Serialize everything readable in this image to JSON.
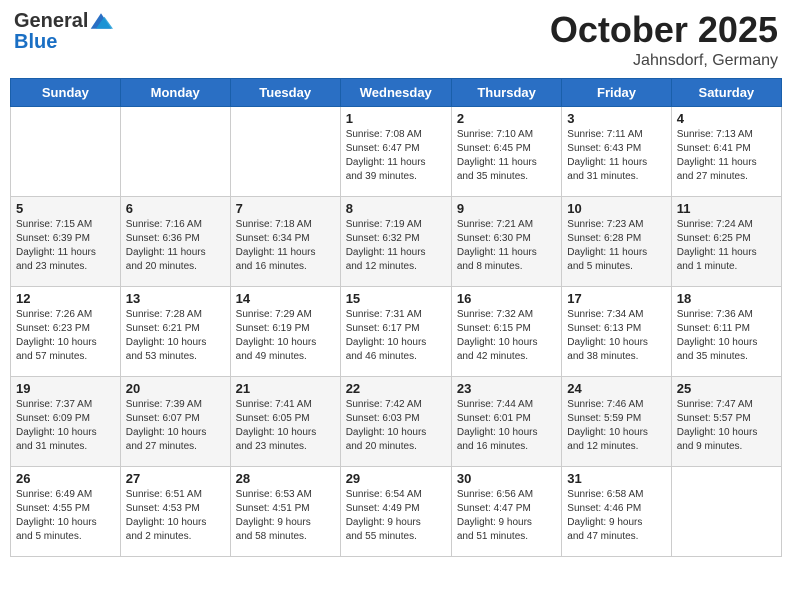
{
  "header": {
    "logo_general": "General",
    "logo_blue": "Blue",
    "month": "October 2025",
    "location": "Jahnsdorf, Germany"
  },
  "days_of_week": [
    "Sunday",
    "Monday",
    "Tuesday",
    "Wednesday",
    "Thursday",
    "Friday",
    "Saturday"
  ],
  "weeks": [
    [
      {
        "day": "",
        "info": ""
      },
      {
        "day": "",
        "info": ""
      },
      {
        "day": "",
        "info": ""
      },
      {
        "day": "1",
        "info": "Sunrise: 7:08 AM\nSunset: 6:47 PM\nDaylight: 11 hours\nand 39 minutes."
      },
      {
        "day": "2",
        "info": "Sunrise: 7:10 AM\nSunset: 6:45 PM\nDaylight: 11 hours\nand 35 minutes."
      },
      {
        "day": "3",
        "info": "Sunrise: 7:11 AM\nSunset: 6:43 PM\nDaylight: 11 hours\nand 31 minutes."
      },
      {
        "day": "4",
        "info": "Sunrise: 7:13 AM\nSunset: 6:41 PM\nDaylight: 11 hours\nand 27 minutes."
      }
    ],
    [
      {
        "day": "5",
        "info": "Sunrise: 7:15 AM\nSunset: 6:39 PM\nDaylight: 11 hours\nand 23 minutes."
      },
      {
        "day": "6",
        "info": "Sunrise: 7:16 AM\nSunset: 6:36 PM\nDaylight: 11 hours\nand 20 minutes."
      },
      {
        "day": "7",
        "info": "Sunrise: 7:18 AM\nSunset: 6:34 PM\nDaylight: 11 hours\nand 16 minutes."
      },
      {
        "day": "8",
        "info": "Sunrise: 7:19 AM\nSunset: 6:32 PM\nDaylight: 11 hours\nand 12 minutes."
      },
      {
        "day": "9",
        "info": "Sunrise: 7:21 AM\nSunset: 6:30 PM\nDaylight: 11 hours\nand 8 minutes."
      },
      {
        "day": "10",
        "info": "Sunrise: 7:23 AM\nSunset: 6:28 PM\nDaylight: 11 hours\nand 5 minutes."
      },
      {
        "day": "11",
        "info": "Sunrise: 7:24 AM\nSunset: 6:25 PM\nDaylight: 11 hours\nand 1 minute."
      }
    ],
    [
      {
        "day": "12",
        "info": "Sunrise: 7:26 AM\nSunset: 6:23 PM\nDaylight: 10 hours\nand 57 minutes."
      },
      {
        "day": "13",
        "info": "Sunrise: 7:28 AM\nSunset: 6:21 PM\nDaylight: 10 hours\nand 53 minutes."
      },
      {
        "day": "14",
        "info": "Sunrise: 7:29 AM\nSunset: 6:19 PM\nDaylight: 10 hours\nand 49 minutes."
      },
      {
        "day": "15",
        "info": "Sunrise: 7:31 AM\nSunset: 6:17 PM\nDaylight: 10 hours\nand 46 minutes."
      },
      {
        "day": "16",
        "info": "Sunrise: 7:32 AM\nSunset: 6:15 PM\nDaylight: 10 hours\nand 42 minutes."
      },
      {
        "day": "17",
        "info": "Sunrise: 7:34 AM\nSunset: 6:13 PM\nDaylight: 10 hours\nand 38 minutes."
      },
      {
        "day": "18",
        "info": "Sunrise: 7:36 AM\nSunset: 6:11 PM\nDaylight: 10 hours\nand 35 minutes."
      }
    ],
    [
      {
        "day": "19",
        "info": "Sunrise: 7:37 AM\nSunset: 6:09 PM\nDaylight: 10 hours\nand 31 minutes."
      },
      {
        "day": "20",
        "info": "Sunrise: 7:39 AM\nSunset: 6:07 PM\nDaylight: 10 hours\nand 27 minutes."
      },
      {
        "day": "21",
        "info": "Sunrise: 7:41 AM\nSunset: 6:05 PM\nDaylight: 10 hours\nand 23 minutes."
      },
      {
        "day": "22",
        "info": "Sunrise: 7:42 AM\nSunset: 6:03 PM\nDaylight: 10 hours\nand 20 minutes."
      },
      {
        "day": "23",
        "info": "Sunrise: 7:44 AM\nSunset: 6:01 PM\nDaylight: 10 hours\nand 16 minutes."
      },
      {
        "day": "24",
        "info": "Sunrise: 7:46 AM\nSunset: 5:59 PM\nDaylight: 10 hours\nand 12 minutes."
      },
      {
        "day": "25",
        "info": "Sunrise: 7:47 AM\nSunset: 5:57 PM\nDaylight: 10 hours\nand 9 minutes."
      }
    ],
    [
      {
        "day": "26",
        "info": "Sunrise: 6:49 AM\nSunset: 4:55 PM\nDaylight: 10 hours\nand 5 minutes."
      },
      {
        "day": "27",
        "info": "Sunrise: 6:51 AM\nSunset: 4:53 PM\nDaylight: 10 hours\nand 2 minutes."
      },
      {
        "day": "28",
        "info": "Sunrise: 6:53 AM\nSunset: 4:51 PM\nDaylight: 9 hours\nand 58 minutes."
      },
      {
        "day": "29",
        "info": "Sunrise: 6:54 AM\nSunset: 4:49 PM\nDaylight: 9 hours\nand 55 minutes."
      },
      {
        "day": "30",
        "info": "Sunrise: 6:56 AM\nSunset: 4:47 PM\nDaylight: 9 hours\nand 51 minutes."
      },
      {
        "day": "31",
        "info": "Sunrise: 6:58 AM\nSunset: 4:46 PM\nDaylight: 9 hours\nand 47 minutes."
      },
      {
        "day": "",
        "info": ""
      }
    ]
  ]
}
